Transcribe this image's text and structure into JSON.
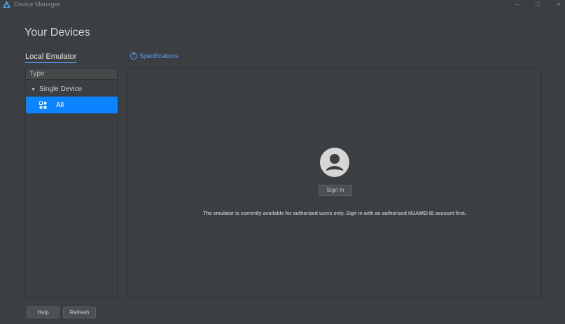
{
  "window": {
    "title": "Device Manager",
    "minimize": "–",
    "maximize": "□",
    "close": "×"
  },
  "page": {
    "title": "Your Devices"
  },
  "tabs": {
    "local_emulator": "Local Emulator"
  },
  "links": {
    "specifications": "Specifications",
    "specifications_icon": "question-circle-icon"
  },
  "tree": {
    "header": "Type",
    "group": {
      "label": "Single Device",
      "expanded": true
    },
    "selected_item": {
      "label": "All",
      "icon": "grid-apps-icon"
    }
  },
  "content": {
    "avatar_icon": "user-avatar-icon",
    "sign_in_label": "Sign In",
    "notice": "The emulator is currently available for authorized users only. Sign in with an authorized HUAWEI ID account first."
  },
  "footer": {
    "help_label": "Help",
    "refresh_label": "Refresh"
  },
  "colors": {
    "background": "#3c3f41",
    "accent": "#0a84ff",
    "link": "#589df6"
  }
}
